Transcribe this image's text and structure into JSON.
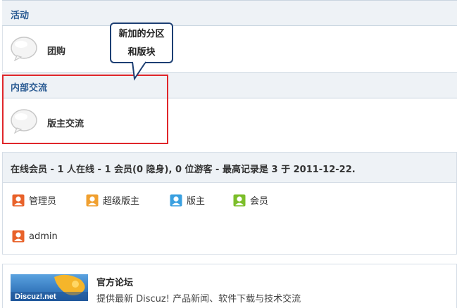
{
  "categories": [
    {
      "title": "活动",
      "forums": [
        {
          "name": "团购"
        }
      ]
    },
    {
      "title": "内部交流",
      "forums": [
        {
          "name": "版主交流"
        }
      ]
    }
  ],
  "callout": {
    "line1": "新加的分区",
    "line2": "和版块"
  },
  "online": {
    "title": "在线会员 - 1 人在线 - 1 会员(0 隐身), 0 位游客 - 最高记录是 3 于 2011-12-22.",
    "legend": [
      {
        "label": "管理员",
        "color": "#e8622a"
      },
      {
        "label": "超级版主",
        "color": "#f0a030"
      },
      {
        "label": "版主",
        "color": "#3aa0e0"
      },
      {
        "label": "会员",
        "color": "#7cbe2a"
      }
    ],
    "users": [
      {
        "name": "admin",
        "color": "#e8622a"
      }
    ]
  },
  "links": {
    "title": "官方论坛",
    "desc": "提供最新 Discuz! 产品新闻、软件下载与技术交流",
    "logo_text": "Discuz!.net"
  }
}
